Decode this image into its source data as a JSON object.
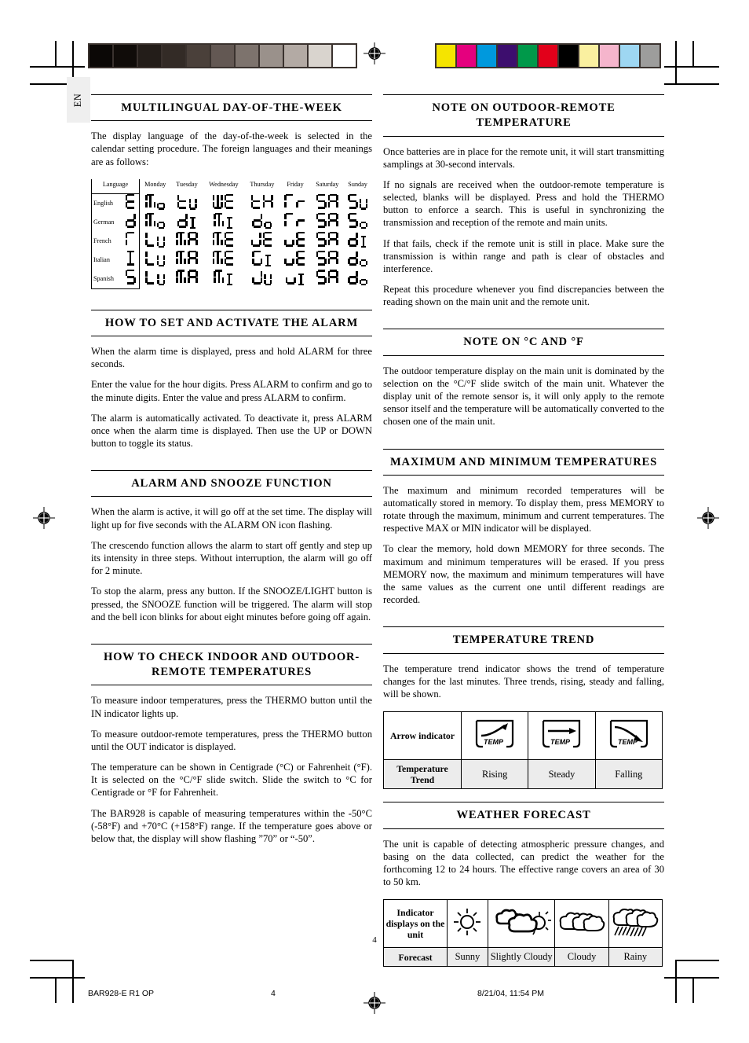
{
  "document": {
    "language_tab": "EN",
    "page_number": "4"
  },
  "footer": {
    "doc_id": "BAR928-E R1 OP",
    "page": "4",
    "timestamp": "8/21/04, 11:54 PM"
  },
  "calibration": {
    "gray_swatches": [
      "#0b0806",
      "#100c09",
      "#231d19",
      "#332b26",
      "#4a403a",
      "#635853",
      "#7d736d",
      "#9a918b",
      "#b3aaa4",
      "#d9d4ce",
      "#ffffff"
    ],
    "color_swatches": [
      "#f5e400",
      "#e5007e",
      "#0099dd",
      "#3d0e6e",
      "#00994a",
      "#e2001a",
      "#000000",
      "#faf0a0",
      "#f5b5cc",
      "#9ed7f2",
      "#9d9d9c"
    ]
  },
  "left_column": {
    "sections": [
      {
        "id": "multilingual-day-of-the-week",
        "title": "MULTILINGUAL DAY-OF-THE-WEEK",
        "paragraphs": [
          "The display language of the day-of-the-week is selected in the calendar setting procedure. The foreign languages and their meanings are as follows:"
        ]
      },
      {
        "id": "how-to-set-and-activate-the-alarm",
        "title": "HOW TO SET AND ACTIVATE THE ALARM",
        "paragraphs": [
          "When the alarm time is displayed, press and hold ALARM for three seconds.",
          "Enter the value for the hour digits. Press ALARM to confirm and go to the minute digits. Enter the value and press ALARM to confirm.",
          "The alarm is automatically activated. To deactivate it, press ALARM once when the alarm time is displayed. Then use the UP or DOWN button to toggle its status."
        ]
      },
      {
        "id": "alarm-and-snooze-function",
        "title": "ALARM AND SNOOZE FUNCTION",
        "paragraphs": [
          "When the alarm is active, it will go off at the set time. The display will light up for five seconds with the ALARM ON icon flashing.",
          "The crescendo function allows the alarm to start off gently and step up its intensity in three steps. Without interruption, the alarm will go off for 2 minute.",
          "To stop the alarm, press any button. If the SNOOZE/LIGHT button is pressed, the SNOOZE function will be triggered. The alarm will stop and the bell icon blinks for about eight minutes before going off again."
        ]
      },
      {
        "id": "how-to-check-indoor-and-outdoor-remote-temperatures",
        "title": "HOW TO CHECK INDOOR AND OUTDOOR-REMOTE TEMPERATURES",
        "paragraphs": [
          "To measure indoor temperatures, press the THERMO button until the IN indicator lights up.",
          "To measure outdoor-remote temperatures, press the THERMO button until the OUT indicator is displayed.",
          "The temperature can be shown in Centigrade (°C) or Fahrenheit (°F). It is selected on the °C/°F slide switch. Slide the switch to °C for Centigrade or °F for Fahrenheit.",
          "The BAR928 is capable of measuring temperatures within the -50°C (-58°F) and +70°C (+158°F) range. If the temperature goes above or below that, the display will show flashing ”70” or “-50”."
        ]
      }
    ]
  },
  "right_column": {
    "sections": [
      {
        "id": "note-on-outdoor-remote-temperature",
        "title": "NOTE ON OUTDOOR-REMOTE TEMPERATURE",
        "paragraphs": [
          "Once batteries are in place for the remote unit, it will start transmitting samplings at 30-second intervals.",
          "If no signals are received when the outdoor-remote  temperature is selected, blanks will be displayed. Press and hold the THERMO button to enforce a search. This is useful in synchronizing the transmission and reception of the remote and main units.",
          "If that fails, check if the remote unit is still in place. Make sure the transmission is within range and path is clear of obstacles and interference.",
          "Repeat this procedure whenever you find discrepancies between the reading shown on the main unit and the remote unit."
        ]
      },
      {
        "id": "note-on-c-and-f",
        "title": "NOTE ON °C AND °F",
        "paragraphs": [
          "The outdoor temperature display on the main unit is dominated by the selection on the °C/°F slide switch of the main unit. Whatever the display unit of the remote sensor is, it will only apply to the remote sensor itself and the temperature will be automatically converted to the chosen one of the main unit."
        ]
      },
      {
        "id": "maximum-and-minimum-temperatures",
        "title": "MAXIMUM AND MINIMUM TEMPERATURES",
        "paragraphs": [
          "The maximum and minimum recorded temperatures will be automatically stored in memory. To display them, press MEMORY to rotate through the maximum, minimum and current temperatures. The respective MAX or MIN indicator will be displayed.",
          "To clear the memory, hold down MEMORY for three seconds. The maximum and minimum temperatures will be erased. If you press MEMORY now, the maximum and minimum temperatures will have the same values as the current one until different readings are recorded."
        ]
      },
      {
        "id": "temperature-trend",
        "title": "TEMPERATURE TREND",
        "paragraphs": [
          "The temperature trend indicator shows the trend of temperature changes for the last minutes. Three trends, rising, steady and falling, will be shown."
        ]
      },
      {
        "id": "weather-forecast",
        "title": "WEATHER FORECAST",
        "paragraphs": [
          "The unit is capable of detecting atmospheric pressure changes, and basing on the data collected, can predict the weather for the forthcoming 12 to 24 hours. The effective range covers an area of 30 to 50 km."
        ]
      }
    ]
  },
  "language_table": {
    "headers": [
      "Language",
      "Monday",
      "Tuesday",
      "Wednesday",
      "Thursday",
      "Friday",
      "Saturday",
      "Sunday"
    ],
    "rows": [
      {
        "language": "English",
        "code": "E",
        "days": [
          "MO",
          "TU",
          "WE",
          "TH",
          "FR",
          "SA",
          "SU"
        ]
      },
      {
        "language": "German",
        "code": "D",
        "days": [
          "MO",
          "DI",
          "MI",
          "DO",
          "FR",
          "SA",
          "SO"
        ]
      },
      {
        "language": "French",
        "code": "F",
        "days": [
          "LU",
          "MA",
          "ME",
          "JE",
          "VE",
          "SA",
          "DI"
        ]
      },
      {
        "language": "Italian",
        "code": "I",
        "days": [
          "LU",
          "MA",
          "ME",
          "GI",
          "VE",
          "SA",
          "DO"
        ]
      },
      {
        "language": "Spanish",
        "code": "S",
        "days": [
          "LU",
          "MA",
          "MI",
          "JU",
          "VI",
          "SA",
          "DO"
        ]
      }
    ]
  },
  "trend_table": {
    "row_labels": [
      "Arrow indicator",
      "Temperature Trend"
    ],
    "columns": [
      {
        "icon": "arrow-rising-icon",
        "icon_caption": "TEMP",
        "label": "Rising"
      },
      {
        "icon": "arrow-steady-icon",
        "icon_caption": "TEMP",
        "label": "Steady"
      },
      {
        "icon": "arrow-falling-icon",
        "icon_caption": "TEMP",
        "label": "Falling"
      }
    ]
  },
  "forecast_table": {
    "row_labels": [
      "Indicator displays on the unit",
      "Forecast"
    ],
    "columns": [
      {
        "icon": "sunny-icon",
        "label": "Sunny"
      },
      {
        "icon": "slightly-cloudy-icon",
        "label": "Slightly Cloudy"
      },
      {
        "icon": "cloudy-icon",
        "label": "Cloudy"
      },
      {
        "icon": "rainy-icon",
        "label": "Rainy"
      }
    ]
  }
}
